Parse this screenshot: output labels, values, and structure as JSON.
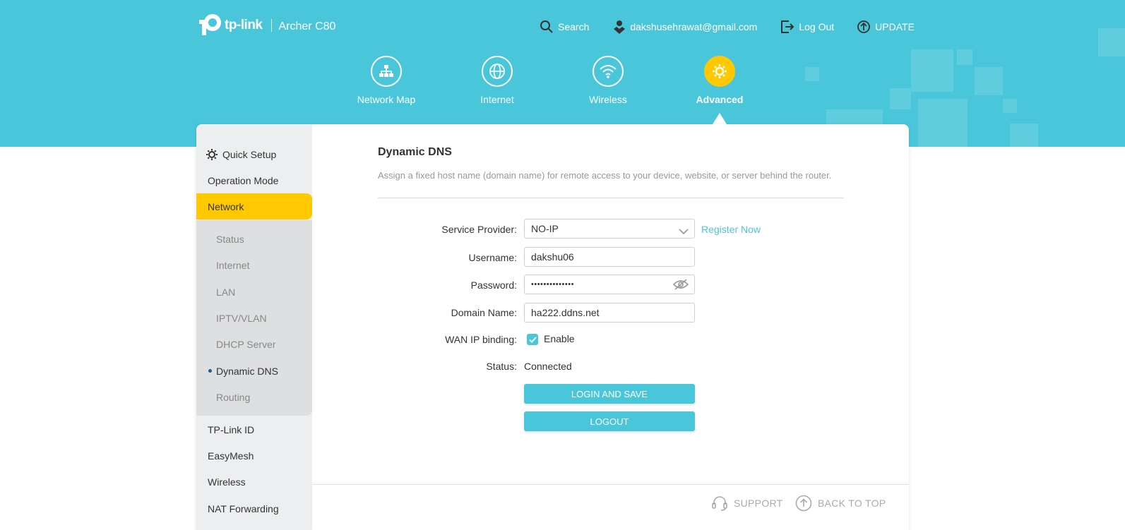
{
  "header": {
    "brand": "tp-link",
    "model": "Archer C80",
    "search_label": "Search",
    "account_email": "dakshusehrawat@gmail.com",
    "logout_label": "Log Out",
    "update_label": "UPDATE"
  },
  "nav": [
    {
      "label": "Network Map",
      "icon": "network-map-icon"
    },
    {
      "label": "Internet",
      "icon": "globe-icon"
    },
    {
      "label": "Wireless",
      "icon": "wifi-icon"
    },
    {
      "label": "Advanced",
      "icon": "gear-icon",
      "active": true
    }
  ],
  "sidebar": {
    "top_items": [
      {
        "label": "Quick Setup",
        "icon": "gear-icon"
      },
      {
        "label": "Operation Mode"
      },
      {
        "label": "Network",
        "active": true
      }
    ],
    "sub_items": [
      {
        "label": "Status"
      },
      {
        "label": "Internet"
      },
      {
        "label": "LAN"
      },
      {
        "label": "IPTV/VLAN"
      },
      {
        "label": "DHCP Server"
      },
      {
        "label": "Dynamic DNS",
        "active": true
      },
      {
        "label": "Routing"
      }
    ],
    "bottom_items": [
      {
        "label": "TP-Link ID"
      },
      {
        "label": "EasyMesh"
      },
      {
        "label": "Wireless"
      },
      {
        "label": "NAT Forwarding"
      }
    ]
  },
  "content": {
    "title": "Dynamic DNS",
    "description": "Assign a fixed host name (domain name) for remote access to your device, website, or server behind the router.",
    "form": {
      "service_provider_label": "Service Provider:",
      "service_provider_value": "NO-IP",
      "register_now": "Register Now",
      "username_label": "Username:",
      "username_value": "dakshu06",
      "password_label": "Password:",
      "password_value": "••••••••••••••",
      "domain_label": "Domain Name:",
      "domain_value": "ha222.ddns.net",
      "wan_binding_label": "WAN IP binding:",
      "wan_binding_option": "Enable",
      "wan_binding_checked": true,
      "status_label": "Status:",
      "status_value": "Connected"
    },
    "buttons": {
      "login_save": "LOGIN AND SAVE",
      "logout": "LOGOUT"
    }
  },
  "footer": {
    "support": "SUPPORT",
    "back_to_top": "BACK TO TOP"
  },
  "colors": {
    "header_bg": "#4ac6da",
    "accent_yellow": "#ffc800",
    "button": "#4ac6da"
  }
}
